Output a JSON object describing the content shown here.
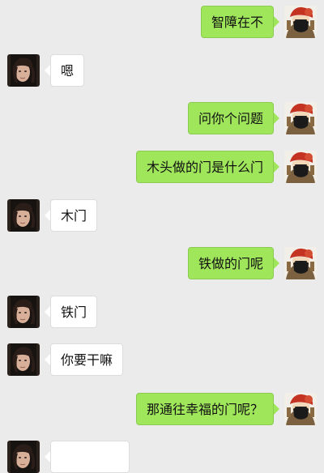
{
  "messages": [
    {
      "side": "right",
      "text": "智障在不"
    },
    {
      "side": "left",
      "text": "嗯"
    },
    {
      "side": "right",
      "text": "问你个问题"
    },
    {
      "side": "right",
      "text": "木头做的门是什么门"
    },
    {
      "side": "left",
      "text": "木门"
    },
    {
      "side": "right",
      "text": "铁做的门呢"
    },
    {
      "side": "left",
      "text": "铁门"
    },
    {
      "side": "left",
      "text": "你要干嘛"
    },
    {
      "side": "right",
      "text": "那通往幸福的门呢？"
    },
    {
      "side": "left",
      "text": ""
    }
  ],
  "icons": {
    "left_avatar": "person-avatar-icon",
    "right_avatar": "anime-avatar-icon"
  }
}
